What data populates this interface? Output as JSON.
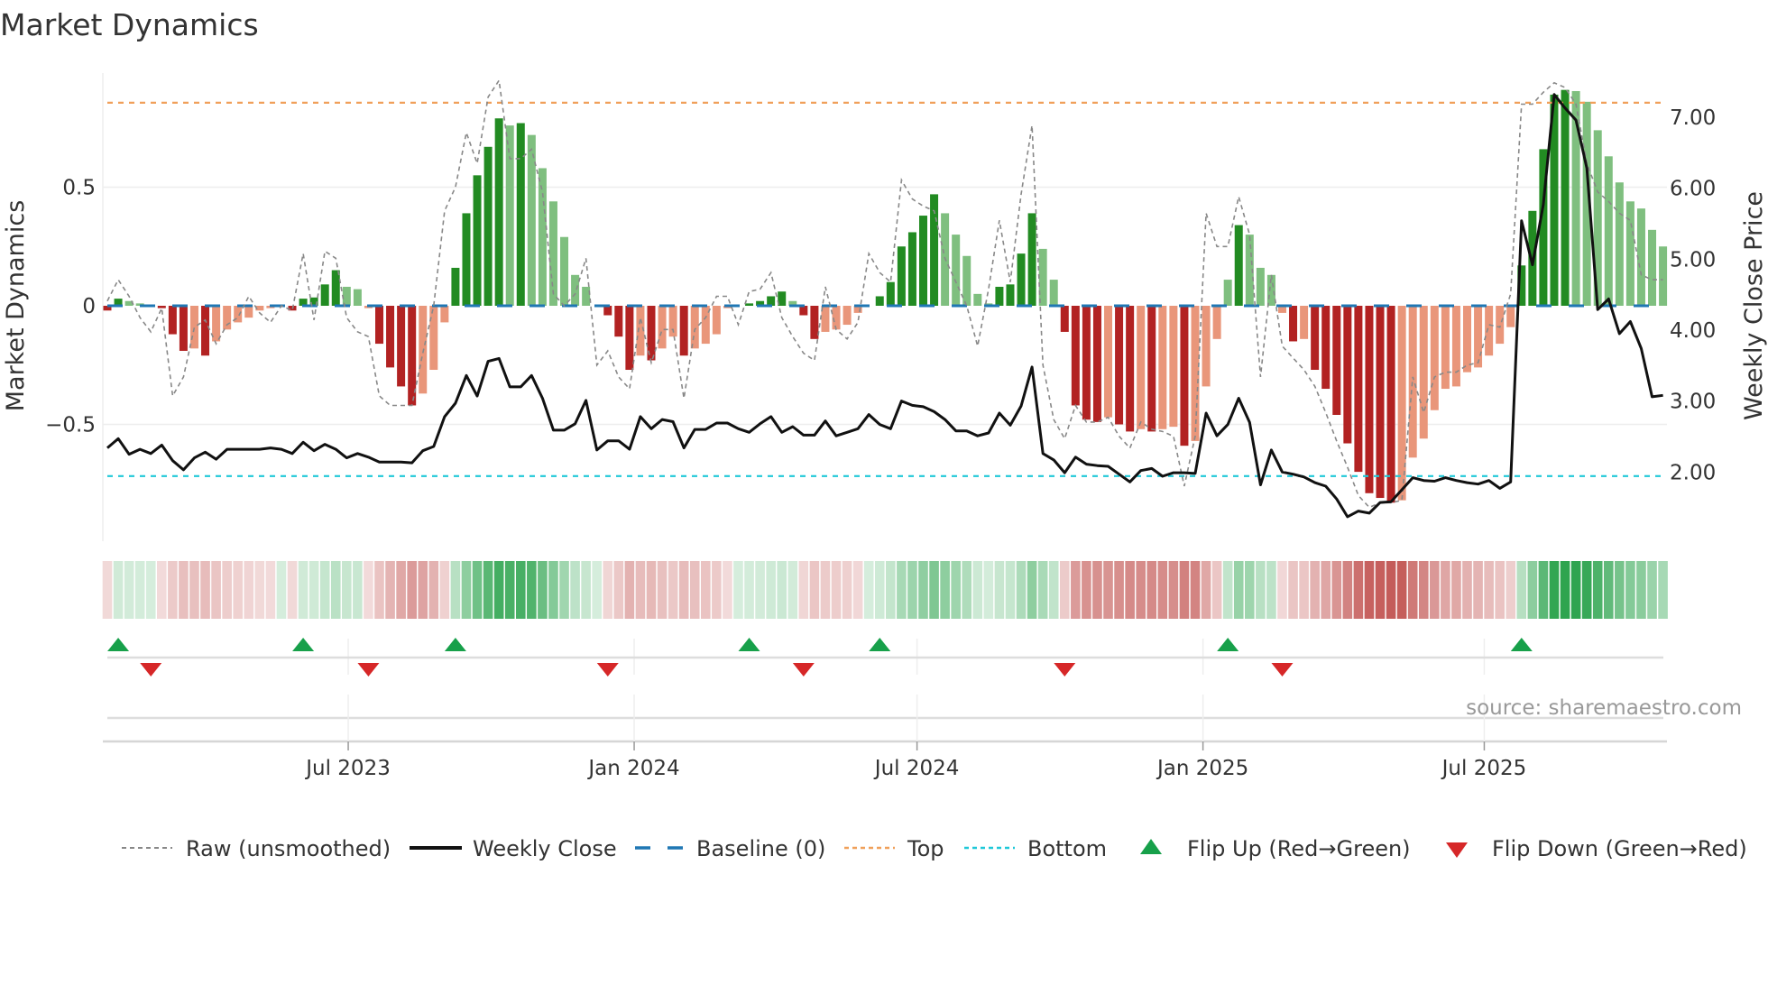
{
  "chart_data": {
    "type": "bar",
    "title": "Market Dynamics",
    "ylabel_left": "Market Dynamics",
    "ylabel_right": "Weekly Close Price",
    "source": "source: sharemaestro.com",
    "x_start_date": "2023-01-27",
    "x_frequency": "weekly",
    "x_ticks": [
      {
        "label": "Jul 2023",
        "date": "2023-07-01"
      },
      {
        "label": "Jan 2024",
        "date": "2024-01-01"
      },
      {
        "label": "Jul 2024",
        "date": "2024-07-01"
      },
      {
        "label": "Jan 2025",
        "date": "2025-01-01"
      },
      {
        "label": "Jul 2025",
        "date": "2025-07-01"
      }
    ],
    "y_left_ticks": [
      {
        "label": "0.5",
        "value": 0.5
      },
      {
        "label": "0",
        "value": 0
      },
      {
        "label": "−0.5",
        "value": -0.5
      }
    ],
    "y_right_ticks": [
      {
        "label": "7.00",
        "value": 7
      },
      {
        "label": "6.00",
        "value": 6
      },
      {
        "label": "5.00",
        "value": 5
      },
      {
        "label": "4.00",
        "value": 4
      },
      {
        "label": "3.00",
        "value": 3
      },
      {
        "label": "2.00",
        "value": 2
      }
    ],
    "top_level": 0.856,
    "bottom_level": -0.718,
    "baseline": 0,
    "grid": true,
    "legend_position": "bottom",
    "series": [
      {
        "name": "Market Dynamics (histogram)",
        "values": [
          -0.02,
          0.03,
          0.02,
          0.01,
          0,
          -0.01,
          -0.12,
          -0.19,
          -0.18,
          -0.21,
          -0.15,
          -0.1,
          -0.07,
          -0.05,
          -0.02,
          -0.01,
          0,
          -0.02,
          0.03,
          0.035,
          0.09,
          0.15,
          0.08,
          0.07,
          -0.01,
          -0.16,
          -0.26,
          -0.34,
          -0.42,
          -0.37,
          -0.27,
          -0.07,
          0.16,
          0.39,
          0.55,
          0.67,
          0.79,
          0.76,
          0.77,
          0.72,
          0.58,
          0.44,
          0.29,
          0.13,
          0.08,
          0,
          -0.04,
          -0.13,
          -0.27,
          -0.21,
          -0.23,
          -0.18,
          -0.13,
          -0.21,
          -0.18,
          -0.16,
          -0.12,
          -0.01,
          0,
          0.01,
          0.02,
          0.04,
          0.06,
          0.02,
          -0.04,
          -0.14,
          -0.11,
          -0.1,
          -0.08,
          -0.03,
          0,
          0.04,
          0.1,
          0.25,
          0.31,
          0.38,
          0.47,
          0.39,
          0.3,
          0.21,
          0.05,
          0.01,
          0.08,
          0.09,
          0.22,
          0.39,
          0.24,
          0.11,
          -0.11,
          -0.42,
          -0.48,
          -0.49,
          -0.47,
          -0.5,
          -0.53,
          -0.52,
          -0.53,
          -0.52,
          -0.51,
          -0.59,
          -0.57,
          -0.34,
          -0.14,
          0.11,
          0.34,
          0.3,
          0.16,
          0.13,
          -0.03,
          -0.15,
          -0.14,
          -0.27,
          -0.35,
          -0.46,
          -0.58,
          -0.7,
          -0.79,
          -0.81,
          -0.83,
          -0.82,
          -0.64,
          -0.56,
          -0.44,
          -0.35,
          -0.34,
          -0.28,
          -0.26,
          -0.21,
          -0.16,
          -0.09,
          0.17,
          0.4,
          0.66,
          0.89,
          0.91,
          0.905,
          0.86,
          0.74,
          0.63,
          0.52,
          0.44,
          0.41,
          0.32,
          0.25
        ]
      },
      {
        "name": "Raw (unsmoothed)",
        "values": [
          0.02,
          0.11,
          0.04,
          -0.05,
          -0.11,
          -0.01,
          -0.38,
          -0.3,
          -0.09,
          -0.06,
          -0.16,
          -0.08,
          -0.05,
          0.04,
          -0.03,
          -0.07,
          0.0,
          -0.02,
          0.22,
          -0.06,
          0.23,
          0.2,
          -0.05,
          -0.11,
          -0.13,
          -0.38,
          -0.42,
          -0.42,
          -0.42,
          -0.2,
          0.0,
          0.4,
          0.5,
          0.73,
          0.6,
          0.88,
          0.95,
          0.62,
          0.62,
          0.66,
          0.48,
          0.05,
          0.0,
          0.05,
          0.2,
          -0.25,
          -0.19,
          -0.3,
          -0.35,
          -0.05,
          -0.24,
          -0.1,
          -0.1,
          -0.39,
          -0.1,
          -0.05,
          0.04,
          0.04,
          -0.08,
          0.06,
          0.07,
          0.14,
          -0.05,
          -0.13,
          -0.2,
          -0.23,
          0.08,
          -0.1,
          -0.14,
          -0.07,
          0.22,
          0.14,
          0.1,
          0.53,
          0.45,
          0.42,
          0.4,
          0.2,
          0.1,
          0.0,
          -0.17,
          0.07,
          0.36,
          0.1,
          0.47,
          0.76,
          -0.25,
          -0.48,
          -0.56,
          -0.42,
          -0.49,
          -0.49,
          -0.47,
          -0.55,
          -0.6,
          -0.49,
          -0.52,
          -0.53,
          -0.55,
          -0.76,
          -0.55,
          0.39,
          0.25,
          0.25,
          0.46,
          0.3,
          -0.3,
          0.13,
          -0.17,
          -0.22,
          -0.27,
          -0.34,
          -0.45,
          -0.57,
          -0.68,
          -0.8,
          -0.85,
          -0.83,
          -0.83,
          -0.82,
          -0.3,
          -0.45,
          -0.3,
          -0.28,
          -0.28,
          -0.25,
          -0.24,
          -0.08,
          -0.09,
          0.05,
          0.85,
          0.85,
          0.9,
          0.94,
          0.92,
          0.85,
          0.6,
          0.48,
          0.44,
          0.39,
          0.36,
          0.13,
          0.11,
          0.11
        ]
      },
      {
        "name": "Weekly Close",
        "axis": "right",
        "values": [
          2.34,
          2.47,
          2.25,
          2.32,
          2.26,
          2.38,
          2.16,
          2.03,
          2.2,
          2.28,
          2.18,
          2.32,
          2.32,
          2.32,
          2.32,
          2.34,
          2.32,
          2.26,
          2.42,
          2.3,
          2.39,
          2.32,
          2.2,
          2.26,
          2.21,
          2.14,
          2.14,
          2.14,
          2.13,
          2.3,
          2.36,
          2.78,
          2.97,
          3.36,
          3.07,
          3.56,
          3.6,
          3.2,
          3.2,
          3.36,
          3.04,
          2.59,
          2.59,
          2.68,
          3.01,
          2.31,
          2.44,
          2.44,
          2.32,
          2.78,
          2.61,
          2.74,
          2.71,
          2.34,
          2.6,
          2.6,
          2.69,
          2.69,
          2.61,
          2.56,
          2.68,
          2.78,
          2.56,
          2.64,
          2.52,
          2.52,
          2.72,
          2.51,
          2.56,
          2.61,
          2.81,
          2.67,
          2.61,
          3.0,
          2.94,
          2.92,
          2.85,
          2.74,
          2.58,
          2.58,
          2.51,
          2.55,
          2.83,
          2.66,
          2.93,
          3.48,
          2.26,
          2.17,
          1.99,
          2.21,
          2.11,
          2.09,
          2.08,
          1.97,
          1.86,
          2.02,
          2.05,
          1.94,
          1.99,
          1.99,
          1.98,
          2.83,
          2.51,
          2.67,
          3.04,
          2.7,
          1.82,
          2.31,
          2.0,
          1.97,
          1.93,
          1.85,
          1.8,
          1.62,
          1.37,
          1.45,
          1.42,
          1.57,
          1.58,
          1.75,
          1.92,
          1.88,
          1.87,
          1.92,
          1.88,
          1.85,
          1.83,
          1.88,
          1.77,
          1.86,
          5.54,
          4.92,
          5.77,
          7.32,
          7.13,
          6.96,
          6.28,
          4.29,
          4.44,
          3.95,
          4.12,
          3.74,
          3.06,
          3.08
        ]
      }
    ],
    "flip_up_weeks": [
      1,
      18,
      32,
      59,
      71,
      103,
      130
    ],
    "flip_down_weeks": [
      4,
      24,
      46,
      64,
      88,
      108
    ],
    "legend": [
      {
        "label": "Raw (unsmoothed)",
        "kind": "raw"
      },
      {
        "label": "Weekly Close",
        "kind": "close"
      },
      {
        "label": "Baseline (0)",
        "kind": "baseline"
      },
      {
        "label": "Top",
        "kind": "top"
      },
      {
        "label": "Bottom",
        "kind": "bottom"
      },
      {
        "label": "Flip Up (Red→Green)",
        "kind": "up"
      },
      {
        "label": "Flip Down (Green→Red)",
        "kind": "down"
      }
    ],
    "colors": {
      "pos_strong": "#228b22",
      "pos_weak": "#7fbf7f",
      "neg_strong": "#b22222",
      "neg_weak": "#e9967a",
      "raw": "#888888",
      "close": "#111111",
      "baseline": "#1f77b4",
      "top": "#f0a05a",
      "bottom": "#1fc8d8",
      "flip_up": "#17a04a",
      "flip_down": "#d62728",
      "heat_pos": "#2ea44f",
      "heat_neg": "#c0504d"
    }
  }
}
